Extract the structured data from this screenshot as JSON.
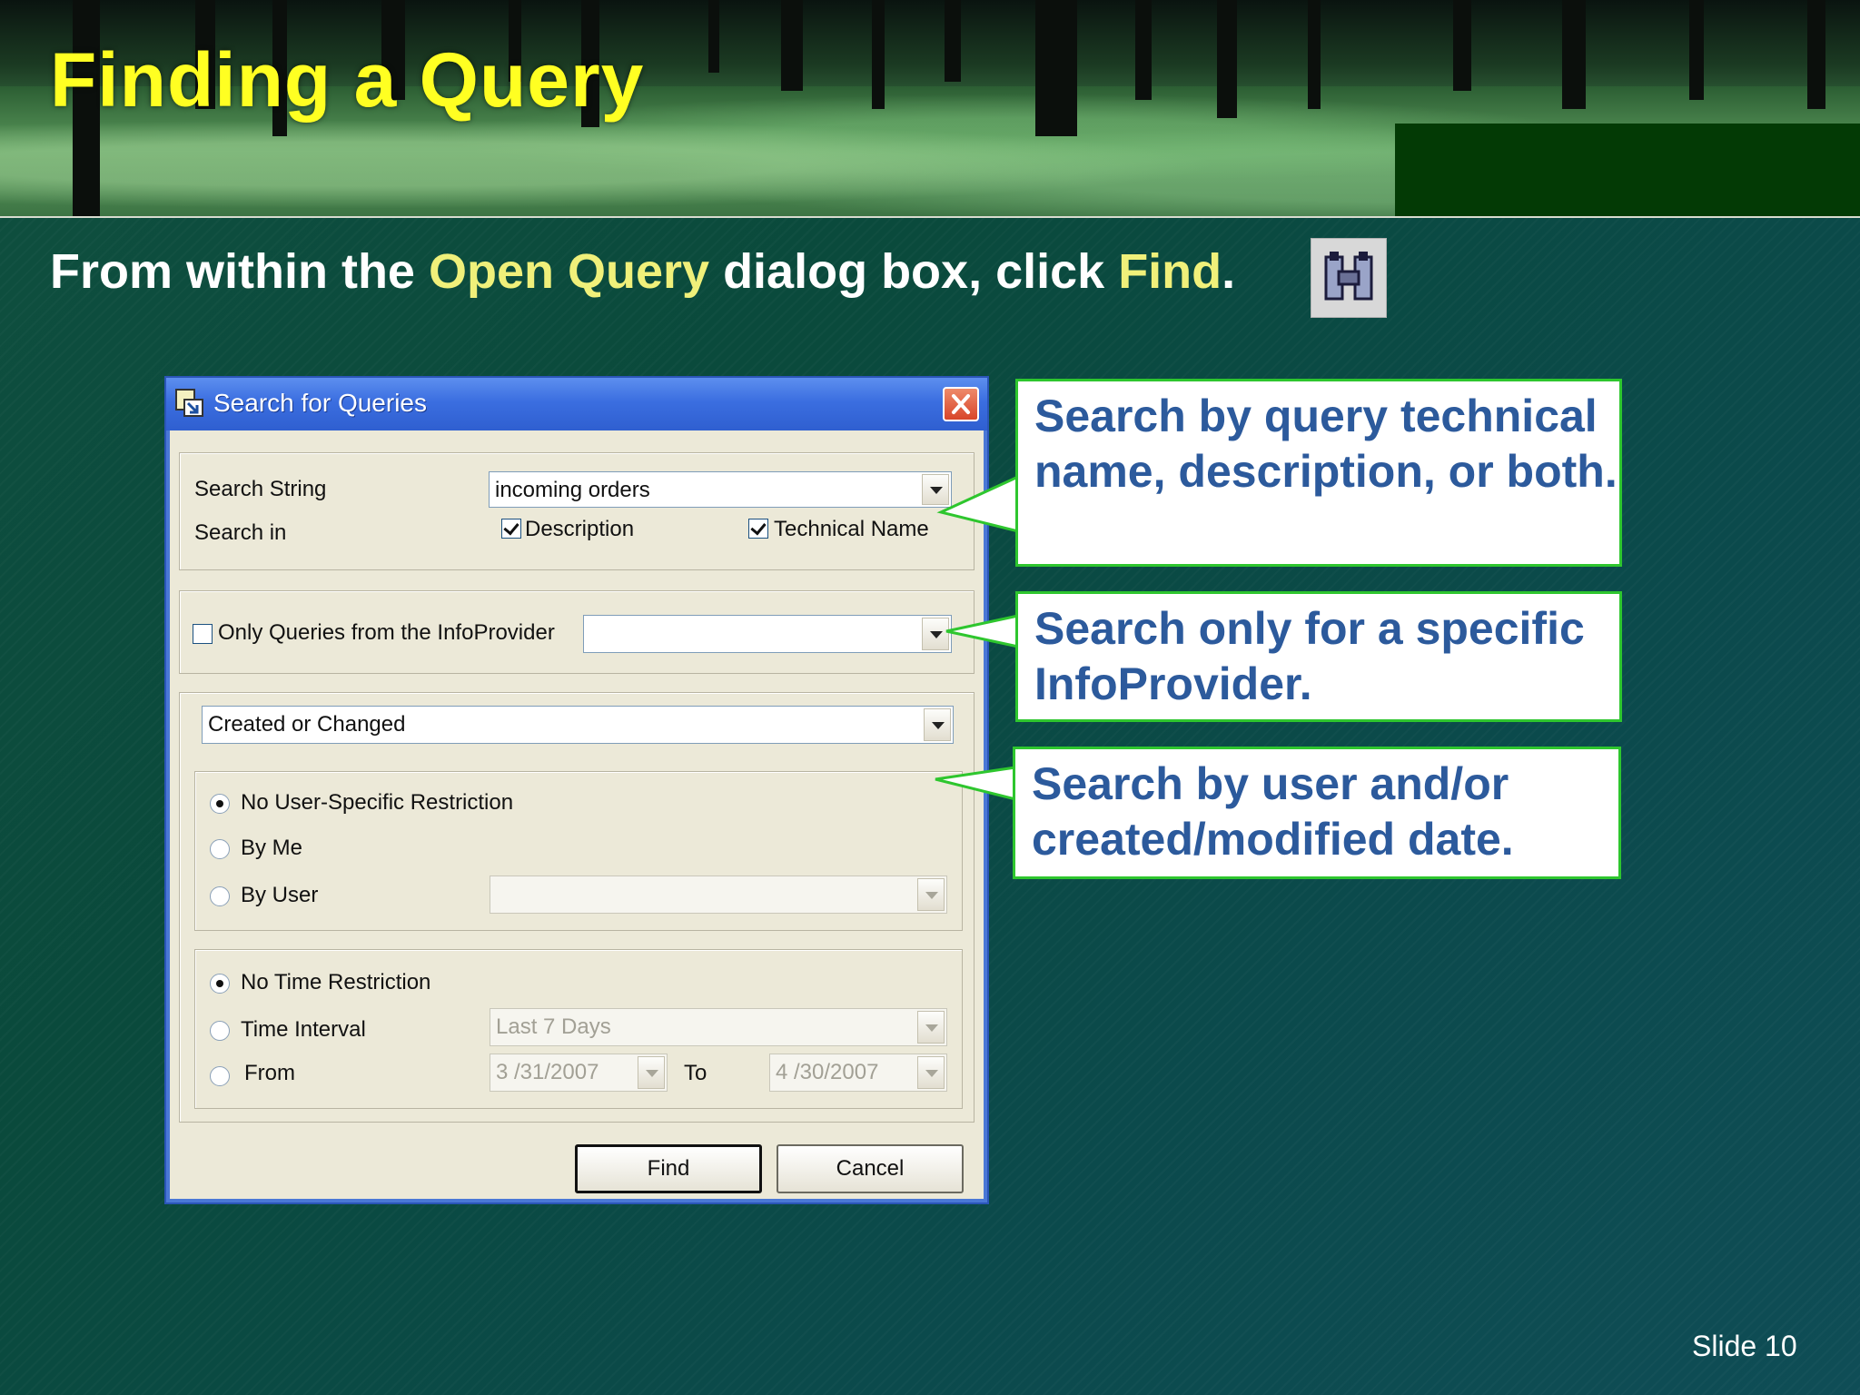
{
  "slide": {
    "title": "Finding a Query",
    "subtitle_prefix": "From within the ",
    "subtitle_highlight1": "Open Query",
    "subtitle_middle": " dialog box, click ",
    "subtitle_highlight2": "Find",
    "subtitle_suffix": ".",
    "slide_number": "Slide 10"
  },
  "dialog": {
    "title": "Search for Queries",
    "search_string_label": "Search String",
    "search_string_value": "incoming orders",
    "search_in_label": "Search in",
    "description_label": "Description",
    "description_checked": true,
    "technical_name_label": "Technical Name",
    "technical_name_checked": true,
    "infoprovider_label": "Only Queries from the InfoProvider",
    "infoprovider_checked": false,
    "infoprovider_value": "",
    "created_changed_value": "Created or Changed",
    "user_options": {
      "no_restriction": "No User-Specific Restriction",
      "by_me": "By Me",
      "by_user": "By User",
      "selected": "no_restriction"
    },
    "time_options": {
      "no_restriction": "No Time Restriction",
      "time_interval": "Time Interval",
      "time_interval_value": "Last 7 Days",
      "from": "From",
      "from_value": "3 /31/2007",
      "to": "To",
      "to_value": "4 /30/2007",
      "selected": "no_restriction"
    },
    "find_button": "Find",
    "cancel_button": "Cancel"
  },
  "callouts": {
    "search_by_name": "Search by query technical name, description, or both.",
    "search_infoprovider": "Search only for a specific InfoProvider.",
    "search_by_user": "Search by user and/or created/modified date."
  },
  "colors": {
    "title": "#ffff22",
    "highlight": "#f0f07a",
    "callout_text": "#2c5a9c",
    "callout_border": "#2ec62e",
    "background": "#0b4a40"
  },
  "icons": {
    "find_icon": "binoculars-icon"
  }
}
